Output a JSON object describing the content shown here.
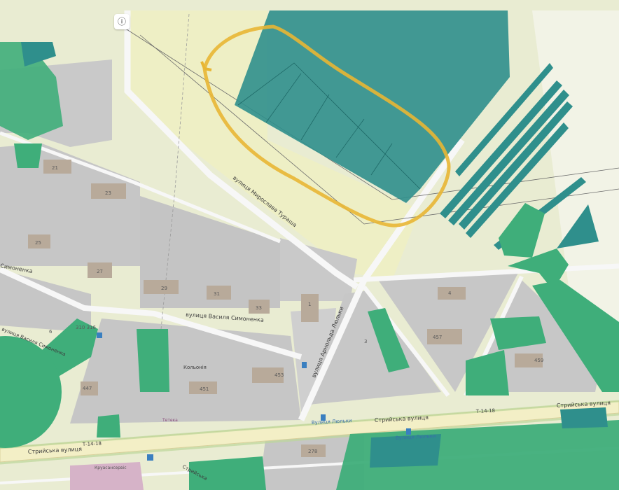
{
  "map": {
    "streets": {
      "turasha": "вулиця Мирослава Тураша",
      "symonenka_main": "вулиця Василя Симоненка",
      "symonenka_left": "Симоненка",
      "symonenka_lower": "вулиця Василя Симоненка",
      "lyulky": "вулиця Арнольда Люльки",
      "stryiska_left": "Стрийська вулиця",
      "stryiska_mid": "Стрийська вулиця",
      "stryiska_right": "Стрийська вулиця",
      "road_code_left": "Т-14-18",
      "road_code_right": "Т-14-18",
      "lower_left_street": "Стрийська"
    },
    "stops": {
      "stop_lyulky_1": "Вулиця Люльки",
      "stop_lyulky_2": "Вулиця Люльки"
    },
    "pois": {
      "kolonia": "Кольонія",
      "teteka": "Тетека",
      "kruasanaria": "Круасансервіс"
    },
    "house_numbers": [
      "21",
      "23",
      "25",
      "27",
      "29",
      "31",
      "33",
      "1",
      "3",
      "6",
      "453",
      "451",
      "447",
      "4",
      "457",
      "459",
      "278",
      "310 316"
    ],
    "colors": {
      "background": "#e9ecd2",
      "building_block": "#c8c8c8",
      "highlight_teal": "#2f8f8c",
      "highlight_green": "#3fae7a",
      "annotation_ring": "#e8b634",
      "road": "#f4f4f4",
      "major_road": "#f3efc6"
    }
  },
  "controls": {
    "info_icon_label": "ⓘ"
  }
}
